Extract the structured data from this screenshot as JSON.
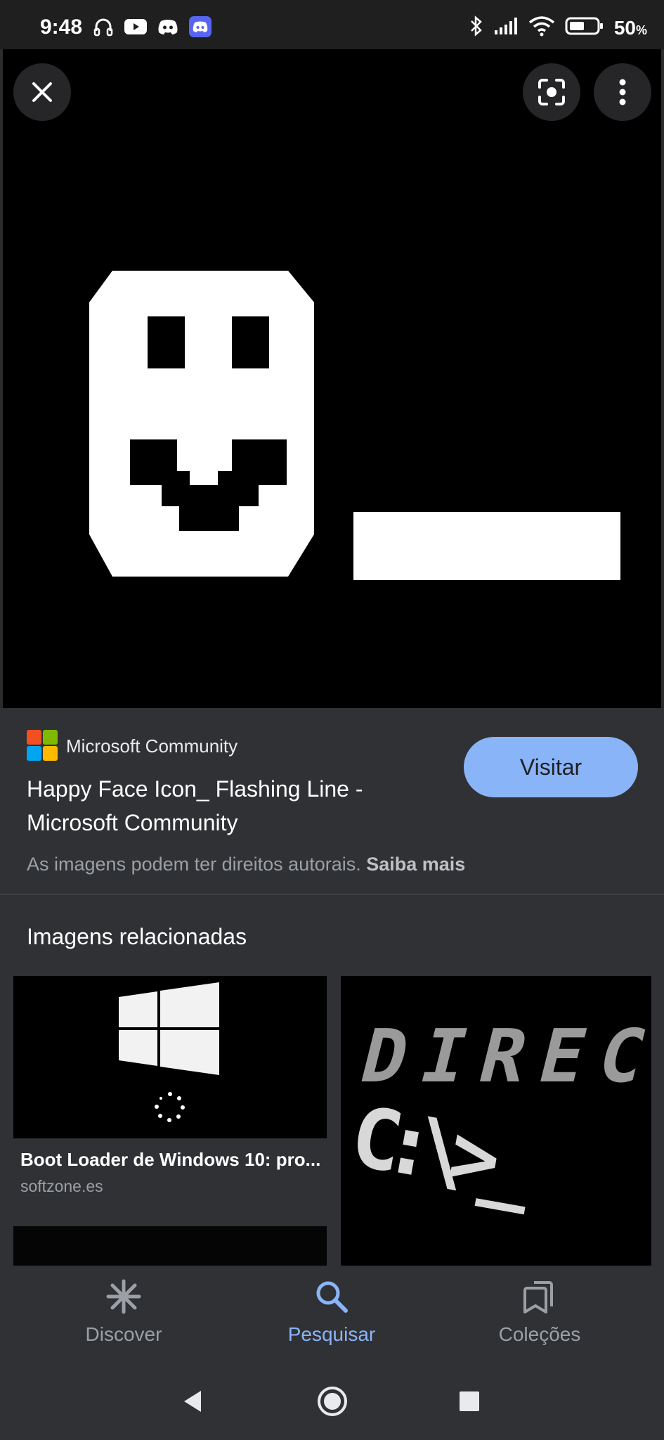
{
  "status_bar": {
    "time": "9:48",
    "battery_percent": "50",
    "battery_unit": "%",
    "left_icons": [
      "headphones-icon",
      "youtube-icon",
      "discord-icon",
      "discord-app-icon"
    ],
    "right_icons": [
      "bluetooth-icon",
      "signal-icon",
      "wifi-icon",
      "battery-icon"
    ]
  },
  "viewer": {
    "buttons": [
      "close-icon",
      "lens-icon",
      "more-vert-icon"
    ]
  },
  "result": {
    "source_name": "Microsoft Community",
    "title": "Happy Face Icon_ Flashing Line - Microsoft Community",
    "visit_label": "Visitar",
    "copyright_text": "As imagens podem ter direitos autorais.",
    "learn_more": "Saiba mais"
  },
  "related": {
    "heading": "Imagens relacionadas",
    "items": [
      {
        "title": "Boot Loader de Windows 10: pro...",
        "source": "softzone.es"
      }
    ],
    "card2_text_top": "DIREC",
    "card2_text_bottom": "C:\\>_"
  },
  "bottom_nav": {
    "items": [
      {
        "label": "Discover",
        "icon": "asterisk-icon",
        "active": false
      },
      {
        "label": "Pesquisar",
        "icon": "search-icon",
        "active": true
      },
      {
        "label": "Coleções",
        "icon": "collections-icon",
        "active": false
      }
    ]
  },
  "colors": {
    "accent": "#8ab4f8",
    "panel": "#303134",
    "muted_text": "#9aa0a6"
  }
}
